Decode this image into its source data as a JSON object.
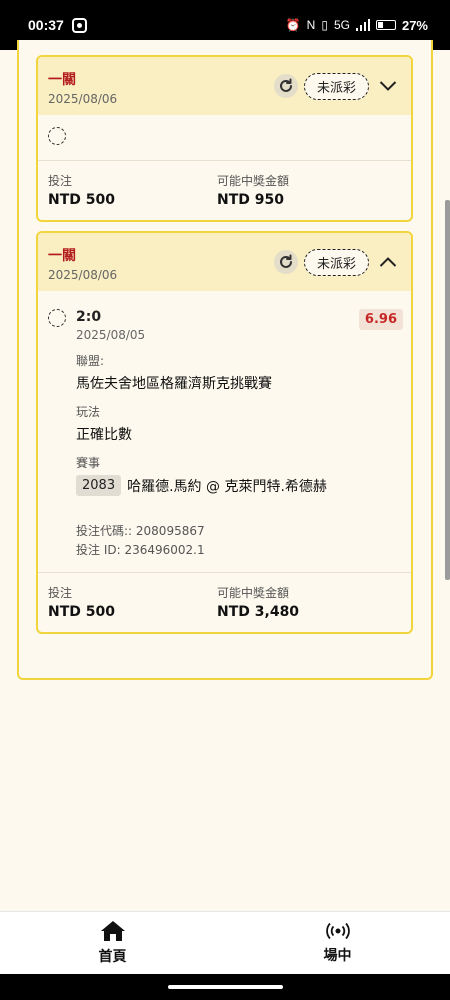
{
  "status_bar": {
    "time": "00:37",
    "icons": [
      "alarm-icon",
      "nfc-icon",
      "vibrate-icon",
      "network-5g-icon",
      "signal-icon"
    ],
    "network_label": "5G",
    "battery_pct": "27%",
    "battery_level": 0.27
  },
  "bets": [
    {
      "type": "一關",
      "date": "2025/08/06",
      "status": "未派彩",
      "expanded": false,
      "stake_label": "投注",
      "stake_value": "NTD 500",
      "payout_label": "可能中獎金額",
      "payout_value": "NTD 950"
    },
    {
      "type": "一關",
      "date": "2025/08/06",
      "status": "未派彩",
      "expanded": true,
      "selection": {
        "score": "2:0",
        "match_date": "2025/08/05",
        "odds": "6.96",
        "league_label": "聯盟:",
        "league_value": "馬佐夫舍地區格羅濟斯克挑戰賽",
        "market_label": "玩法",
        "market_value": "正確比數",
        "event_label": "賽事",
        "event_code": "2083",
        "event_name": "哈羅德.馬約 @ 克萊門特.希德赫",
        "ticket_code": "投注代碼:: 208095867",
        "bet_id": "投注 ID: 236496002.1"
      },
      "stake_label": "投注",
      "stake_value": "NTD 500",
      "payout_label": "可能中獎金額",
      "payout_value": "NTD 3,480"
    }
  ],
  "bottom_nav": {
    "items": [
      {
        "label": "首頁",
        "icon": "home-icon"
      },
      {
        "label": "場中",
        "icon": "live-broadcast-icon"
      }
    ]
  }
}
